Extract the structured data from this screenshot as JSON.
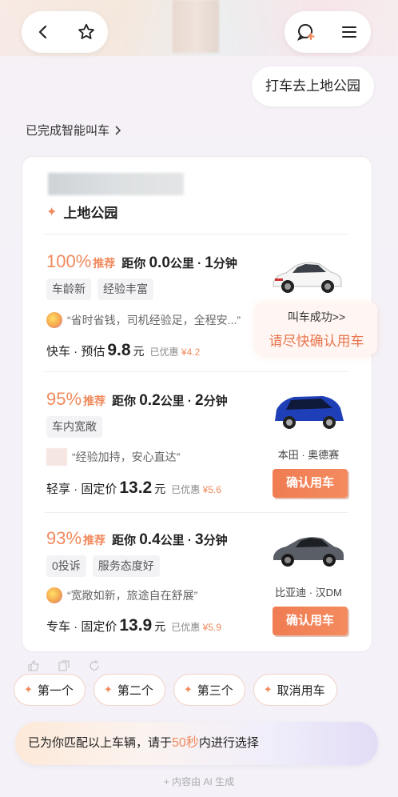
{
  "nav": {
    "back_icon": "chevron-left-icon",
    "star_icon": "star-icon",
    "new_chat_icon": "chat-plus-icon",
    "menu_icon": "menu-icon"
  },
  "user_message": "打车去上地公园",
  "status_line": "已完成智能叫车",
  "destination": "上地公园",
  "options": [
    {
      "percent": "100%",
      "recommend": "推荐",
      "distance_prefix": "距你",
      "distance": "0.0",
      "distance_unit": "公里",
      "time": "1",
      "time_unit": "分钟",
      "tags": [
        "车龄新",
        "经验丰富"
      ],
      "quote": "“省时省钱，司机经验足，全程安...”",
      "price_label": "快车 · 预估",
      "price": "9.8",
      "yuan": "元",
      "discount_label": "已优惠",
      "discount": "¥4.2",
      "car_name": "",
      "button": "",
      "car_color": "#ffffff"
    },
    {
      "percent": "95%",
      "recommend": "推荐",
      "distance_prefix": "距你",
      "distance": "0.2",
      "distance_unit": "公里",
      "time": "2",
      "time_unit": "分钟",
      "tags": [
        "车内宽敞"
      ],
      "quote": "“经验加持，安心直达”",
      "price_label": "轻享 · 固定价",
      "price": "13.2",
      "yuan": "元",
      "discount_label": "已优惠",
      "discount": "¥5.6",
      "car_name": "本田 · 奥德赛",
      "button": "确认用车",
      "car_color": "#1f3fb8"
    },
    {
      "percent": "93%",
      "recommend": "推荐",
      "distance_prefix": "距你",
      "distance": "0.4",
      "distance_unit": "公里",
      "time": "3",
      "time_unit": "分钟",
      "tags": [
        "0投诉",
        "服务态度好"
      ],
      "quote": "“宽敞如新，旅途自在舒展”",
      "price_label": "专车 · 固定价",
      "price": "13.9",
      "yuan": "元",
      "discount_label": "已优惠",
      "discount": "¥5.9",
      "car_name": "比亚迪 · 汉DM",
      "button": "确认用车",
      "car_color": "#5a5e66"
    }
  ],
  "toast": {
    "line1": "叫车成功>>",
    "line2": "请尽快确认用车"
  },
  "chips": [
    "第一个",
    "第二个",
    "第三个",
    "取消用车"
  ],
  "timer": {
    "prefix": "已为你匹配以上车辆，请于",
    "seconds": "50秒",
    "suffix": "内进行选择"
  },
  "ai_note": "+ 内容由 AI 生成",
  "colors": {
    "accent": "#f08a5d",
    "button": "#f07c52"
  }
}
